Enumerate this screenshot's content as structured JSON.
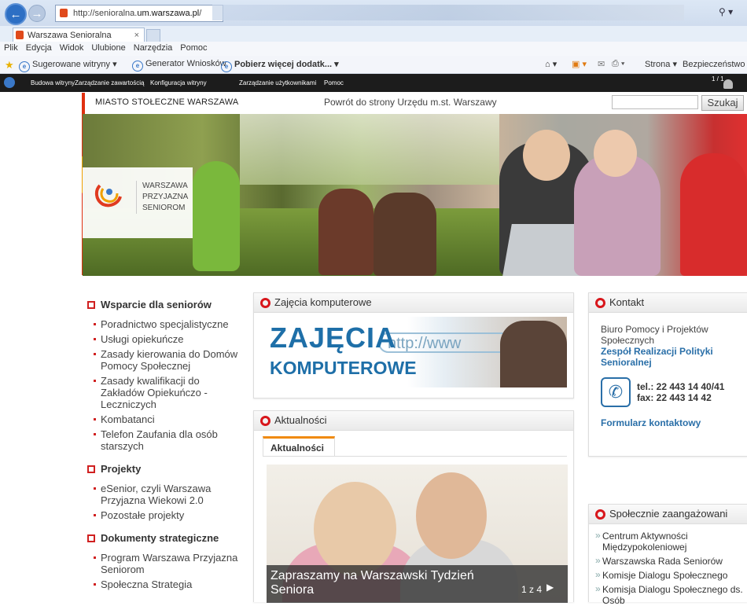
{
  "browser": {
    "url_prefix": "http://senioralna.",
    "url_domain": "um.warszawa.pl",
    "url_suffix": "/",
    "tab_title": "Warszawa Senioralna",
    "tab_close": "×",
    "search_glyph": "⚲ ▾",
    "menu": [
      "Plik",
      "Edycja",
      "Widok",
      "Ulubione",
      "Narzędzia",
      "Pomoc"
    ],
    "favorites": {
      "suggested": "Sugerowane witryny ▾",
      "generator": "Generator Wniosków",
      "more_addons": "Pobierz więcej dodatk... ▾",
      "page_menu": "Strona ▾",
      "security_menu": "Bezpieczeństwo ▾"
    }
  },
  "admin_bar": {
    "items": [
      "Budowa witryny",
      "Zarządzanie zawartością",
      "Konfiguracja witryny",
      "Zarządzanie użytkownikami",
      "Pomoc"
    ],
    "page_counter": "1 / 1"
  },
  "header": {
    "city": "MIASTO STOŁECZNE WARSZAWA",
    "back_link": "Powrót do strony Urzędu m.st. Warszawy",
    "search_button": "Szukaj",
    "logo_lines": [
      "WARSZAWA",
      "PRZYJAZNA",
      "SENIOROM"
    ]
  },
  "left_nav": {
    "sections": [
      {
        "title": "Wsparcie dla seniorów",
        "links": [
          "Poradnictwo specjalistyczne",
          "Usługi opiekuńcze",
          "Zasady kierowania do Domów Pomocy Społecznej",
          "Zasady kwalifikacji do Zakładów Opiekuńczo - Leczniczych",
          "Kombatanci",
          "Telefon Zaufania dla osób starszych"
        ]
      },
      {
        "title": "Projekty",
        "links": [
          "eSenior, czyli Warszawa Przyjazna Wiekowi 2.0",
          "Pozostałe projekty"
        ]
      },
      {
        "title": "Dokumenty strategiczne",
        "links": [
          "Program Warszawa Przyjazna Seniorom",
          "Społeczna Strategia"
        ]
      }
    ]
  },
  "center": {
    "computer_box_title": "Zajęcia komputerowe",
    "computer_banner_line1": "ZAJĘCIA",
    "computer_banner_line2": "KOMPUTEROWE",
    "computer_banner_http": "http://www",
    "news_box_title": "Aktualności",
    "news_tab": "Aktualności",
    "news_caption": "Zapraszamy na Warszawski Tydzień Seniora",
    "news_pager": "1 z 4",
    "news_next": "▶"
  },
  "right": {
    "contact_title": "Kontakt",
    "office": "Biuro Pomocy i Projektów Społecznych",
    "team": "Zespół Realizacji Polityki Senioralnej",
    "phone": "tel.: 22 443 14 40/41",
    "fax": "fax: 22 443 14 42",
    "form_link": "Formularz kontaktowy",
    "engaged_title": "Społecznie zaangażowani",
    "engaged_links": [
      "Centrum Aktywności Międzypokoleniowej",
      "Warszawska Rada Seniorów",
      "Komisje Dialogu Społecznego"
    ],
    "engaged_sub": "Komisja Dialogu Społecznego ds. Osób"
  }
}
